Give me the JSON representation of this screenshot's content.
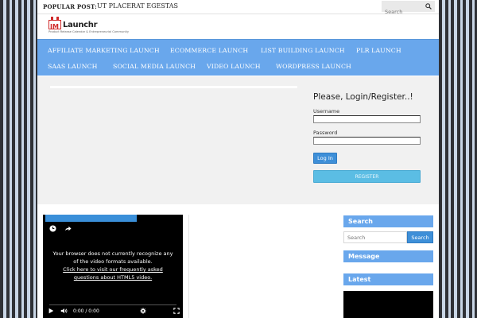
{
  "topbar": {
    "popular_label": "POPULAR POST:",
    "popular_link": "UT PLACERAT EGESTAS",
    "search_placeholder": "Search"
  },
  "logo": {
    "mark": "IM",
    "name": "Launchr",
    "tagline": "Product Release Calendar & Entrepreneurial Community"
  },
  "nav": {
    "items": [
      "AFFILIATE MARKETING LAUNCH",
      "ECOMMERCE LAUNCH",
      "LIST BUILDING LAUNCH",
      "PLR LAUNCH",
      "SAAS LAUNCH",
      "SOCIAL MEDIA LAUNCH",
      "VIDEO LAUNCH",
      "WORDPRESS LAUNCH"
    ]
  },
  "login": {
    "title": "Please, Login/Register..!",
    "username_label": "Username",
    "password_label": "Password",
    "login_button": "Log In",
    "register_button": "REGISTER"
  },
  "video": {
    "message_line1": "Your browser does not currently recognize any",
    "message_line2": "of the video formats available.",
    "link_line1": "Click here to visit our frequently asked",
    "link_line2": "questions about HTML5 video.",
    "time": "0:00 / 0:00"
  },
  "sidebar": {
    "search_title": "Search",
    "search_placeholder": "Search",
    "search_button": "Search",
    "message_title": "Message",
    "latest_title": "Latest"
  },
  "colors": {
    "nav_blue": "#69a7ec",
    "button_blue": "#3e8fd8",
    "register_blue": "#5bbde4"
  }
}
